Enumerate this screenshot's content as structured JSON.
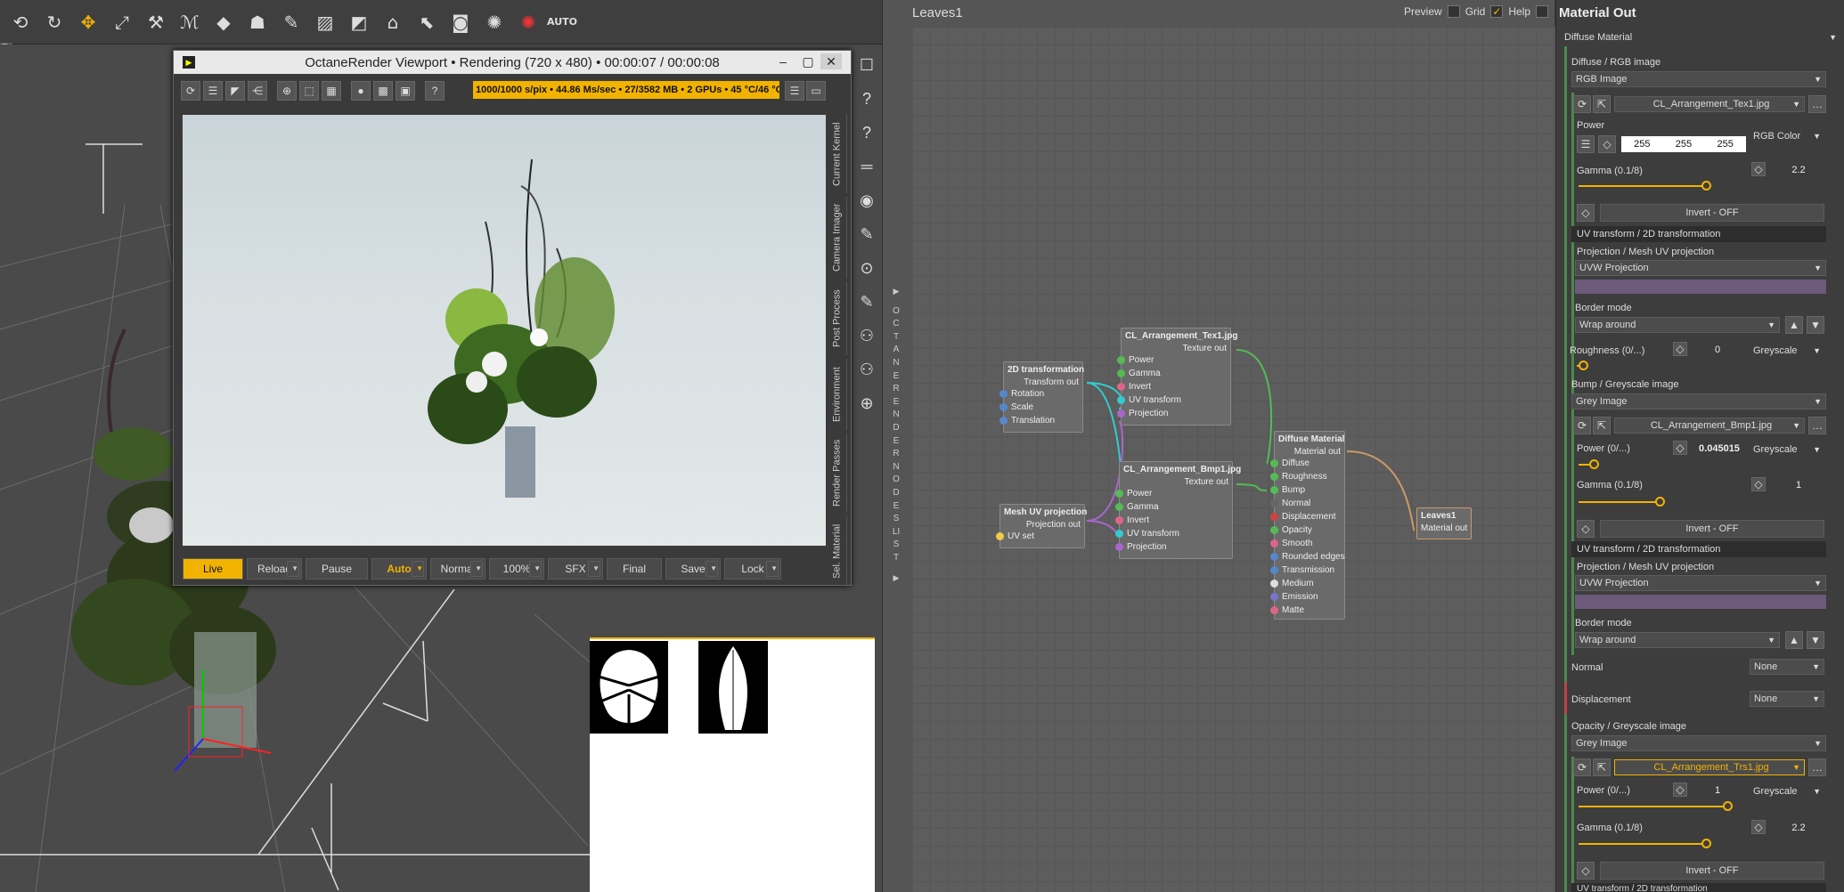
{
  "toolbar": {
    "icons": [
      "rotate-icon",
      "orbit-icon",
      "move-icon",
      "scale-icon",
      "joint-icon",
      "node-icon",
      "paint-icon",
      "figure-icon",
      "morph-icon",
      "region-icon",
      "select-tool-icon",
      "camera-icon",
      "pointer-icon",
      "render-icon",
      "octane-icon",
      "octane-red-icon",
      "auto-icon"
    ],
    "auto_label": "AUTO"
  },
  "viewport": {
    "corner_label": "E"
  },
  "octane_window": {
    "title": "OctaneRender Viewport • Rendering (720 x 480) • 00:00:07 / 00:00:08",
    "status": "1000/1000 s/pix • 44.86 Ms/sec • 27/3582 MB • 2 GPUs • 45 °C/46 °C",
    "side_tabs": [
      "Current Kernel",
      "Camera Imager",
      "Post Process",
      "Environment",
      "Render Passes",
      "Sel. Material"
    ],
    "bottom_buttons": [
      {
        "label": "Live"
      },
      {
        "label": "Reload"
      },
      {
        "label": "Pause"
      },
      {
        "label": "Auto"
      },
      {
        "label": "Normal"
      },
      {
        "label": "100%"
      },
      {
        "label": "SFX"
      },
      {
        "label": "Final"
      },
      {
        "label": "Save"
      },
      {
        "label": "Lock"
      }
    ]
  },
  "node_editor": {
    "title": "Leaves1",
    "preview_label": "Preview",
    "grid_label": "Grid",
    "help_label": "Help",
    "side_list": "OCTANE RENDER NODES LIST",
    "nodes": {
      "transform": {
        "title": "2D transformation",
        "out": "Transform out",
        "inputs": [
          "Rotation",
          "Scale",
          "Translation"
        ]
      },
      "meshuv": {
        "title": "Mesh UV projection",
        "out": "Projection out",
        "inputs": [
          "UV set"
        ]
      },
      "tex1": {
        "title": "CL_Arrangement_Tex1.jpg",
        "out": "Texture out",
        "inputs": [
          "Power",
          "Gamma",
          "Invert",
          "UV transform",
          "Projection"
        ]
      },
      "bmp1": {
        "title": "CL_Arrangement_Bmp1.jpg",
        "out": "Texture out",
        "inputs": [
          "Power",
          "Gamma",
          "Invert",
          "UV transform",
          "Projection"
        ]
      },
      "diffuse": {
        "title": "Diffuse Material",
        "out": "Material out",
        "inputs": [
          "Diffuse",
          "Roughness",
          "Bump",
          "Normal",
          "Displacement",
          "Opacity",
          "Smooth",
          "Rounded edges",
          "Transmission",
          "Medium",
          "Emission",
          "Matte"
        ]
      },
      "leaves": {
        "title": "Leaves1",
        "out": "Material out"
      }
    }
  },
  "material_panel": {
    "title": "Material Out",
    "material_type": "Diffuse Material",
    "diffuse_label": "Diffuse / RGB image",
    "diffuse_type": "RGB Image",
    "diffuse_file": "CL_Arrangement_Tex1.jpg",
    "power_label": "Power",
    "rgb": [
      "255",
      "255",
      "255"
    ],
    "rgb_mode": "RGB Color",
    "gamma_label": "Gamma (0.1/8)",
    "gamma1": "2.2",
    "invert": "Invert - OFF",
    "uv_transform": "UV transform / 2D transformation",
    "projection_label": "Projection / Mesh UV projection",
    "projection_type": "UVW Projection",
    "border_label": "Border mode",
    "border_value": "Wrap around",
    "roughness_label": "Roughness (0/...)",
    "roughness_value": "0",
    "greyscale": "Greyscale",
    "bump_label": "Bump / Greyscale image",
    "grey_image": "Grey Image",
    "bump_file": "CL_Arrangement_Bmp1.jpg",
    "bump_power_label": "Power (0/...)",
    "bump_power": "0.045015",
    "bump_gamma": "1",
    "normal_label": "Normal",
    "none": "None",
    "displacement_label": "Displacement",
    "opacity_label": "Opacity / Greyscale image",
    "opacity_file": "CL_Arrangement_Trs1.jpg",
    "opacity_power": "1",
    "opacity_gamma": "2.2",
    "cut_label": "UV transform / 2D transformation"
  }
}
